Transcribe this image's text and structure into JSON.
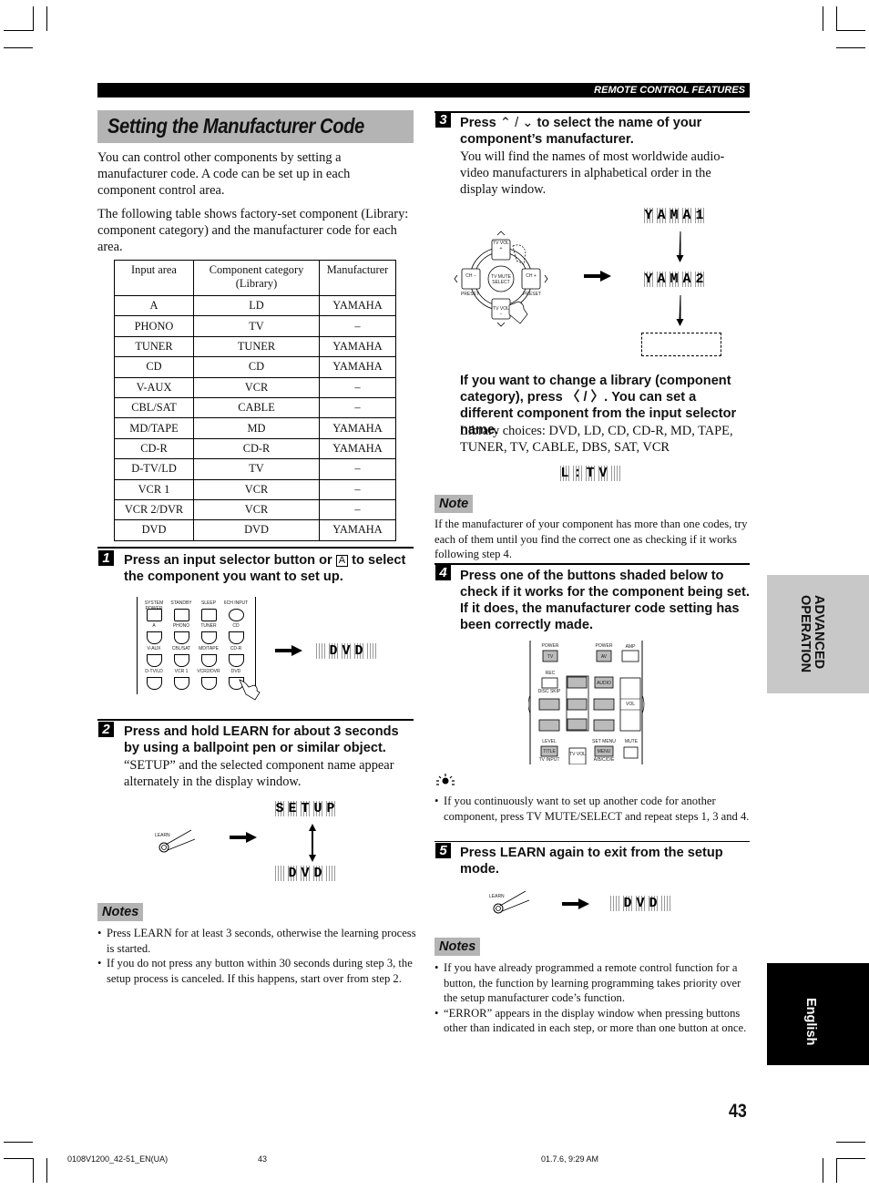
{
  "header": {
    "section": "REMOTE CONTROL FEATURES"
  },
  "title": "Setting the Manufacturer Code",
  "intro": [
    "You can control other components by setting a manufacturer code. A code can be set up in each component control area.",
    "The following table shows factory-set component (Library: component category) and the manufacturer code for each area."
  ],
  "table": {
    "headers": [
      "Input area",
      "Component category (Library)",
      "Manufacturer"
    ],
    "rows": [
      [
        "A",
        "LD",
        "YAMAHA"
      ],
      [
        "PHONO",
        "TV",
        "–"
      ],
      [
        "TUNER",
        "TUNER",
        "YAMAHA"
      ],
      [
        "CD",
        "CD",
        "YAMAHA"
      ],
      [
        "V-AUX",
        "VCR",
        "–"
      ],
      [
        "CBL/SAT",
        "CABLE",
        "–"
      ],
      [
        "MD/TAPE",
        "MD",
        "YAMAHA"
      ],
      [
        "CD-R",
        "CD-R",
        "YAMAHA"
      ],
      [
        "D-TV/LD",
        "TV",
        "–"
      ],
      [
        "VCR 1",
        "VCR",
        "–"
      ],
      [
        "VCR 2/DVR",
        "VCR",
        "–"
      ],
      [
        "DVD",
        "DVD",
        "YAMAHA"
      ]
    ]
  },
  "steps": [
    {
      "num": "1",
      "heading_pre": "Press an input selector button or ",
      "heading_key": "A",
      "heading_post": " to select the component you want to set up.",
      "body": ""
    },
    {
      "num": "2",
      "heading": "Press and hold LEARN for about 3 seconds by using a ballpoint pen or similar object.",
      "body": "“SETUP” and the selected component name appear alternately in the display window."
    },
    {
      "num": "3",
      "heading_pre": "Press ",
      "heading_post": " to select the name of your component’s manufacturer.",
      "body": "You will find the names of most worldwide audio-video manufacturers in alphabetical order in the display window."
    },
    {
      "num": "4",
      "heading": "Press one of the buttons shaded below to check if it works for the component being set. If it does, the manufacturer code setting has been correctly made."
    },
    {
      "num": "5",
      "heading": "Press LEARN again to exit from the setup mode."
    }
  ],
  "library": {
    "heading": "If you want to change a library (component category), press 〈 / 〉. You can set a different component from the input selector name.",
    "choices": "Library choices: DVD, LD, CD, CD-R, MD, TAPE, TUNER, TV, CABLE, DBS, SAT, VCR"
  },
  "remote1": {
    "labels": [
      "SYSTEM POWER",
      "STANDBY",
      "SLEEP",
      "6CH INPUT",
      "A",
      "PHONO",
      "TUNER",
      "CD",
      "V-AUX",
      "CBL/SAT",
      "MD/TAPE",
      "CD-R",
      "D-TV/LD",
      "VCR 1",
      "VCR2/DVR",
      "DVD"
    ]
  },
  "remote3": {
    "labels": {
      "up": "TV VOL +",
      "down": "TV VOL −",
      "left": "CH −",
      "right": "CH +",
      "center": "TV MUTE SELECT",
      "preset": "PRESET"
    }
  },
  "remote4": {
    "labels": [
      "POWER",
      "TV",
      "POWER",
      "AV",
      "AMP",
      "REC",
      "DISC SKIP",
      "AUDIO",
      "VOL",
      "LEVEL",
      "TITLE",
      "TV INPUT",
      "SET MENU",
      "MENU",
      "A/B/C/D/E",
      "MUTE",
      "TV VOL"
    ]
  },
  "displays": {
    "step1": [
      "",
      "D",
      "V",
      "D",
      ""
    ],
    "step2_a": [
      "S",
      "E",
      "T",
      "U",
      "P"
    ],
    "step2_b": [
      "",
      "D",
      "V",
      "D",
      ""
    ],
    "step3_a": [
      "Y",
      "A",
      "M",
      "A",
      "1"
    ],
    "step3_b": [
      "Y",
      "A",
      "M",
      "A",
      "2"
    ],
    "library": [
      "L",
      ":",
      "T",
      "V",
      ""
    ],
    "step5": [
      "",
      "D",
      "V",
      "D",
      ""
    ]
  },
  "learn_label": "LEARN",
  "note_labels": {
    "notes": "Notes",
    "note": "Note"
  },
  "notes_left": [
    "Press LEARN for at least 3 seconds, otherwise the learning process is started.",
    "If you do not press any button within 30 seconds during step 3, the setup process is canceled. If this happens, start over from step 2."
  ],
  "note_mid": "If the manufacturer of your component has more than one codes, try each of them until you find the correct one as checking if it works following step 4.",
  "tip": "If you continuously want to set up another code for another component, press TV MUTE/SELECT and repeat steps 1, 3 and 4.",
  "notes_right": [
    "If you have already programmed a remote control function for a button, the function by learning programming takes priority over the setup manufacturer code’s function.",
    "“ERROR” appears in the display window when pressing buttons other than indicated in each step, or more than one button at once."
  ],
  "side_tabs": {
    "advanced": "ADVANCED OPERATION",
    "english": "English"
  },
  "page_number": "43",
  "footer": {
    "file": "0108V1200_42-51_EN(UA)",
    "page": "43",
    "timestamp": "01.7.6, 9:29 AM"
  }
}
